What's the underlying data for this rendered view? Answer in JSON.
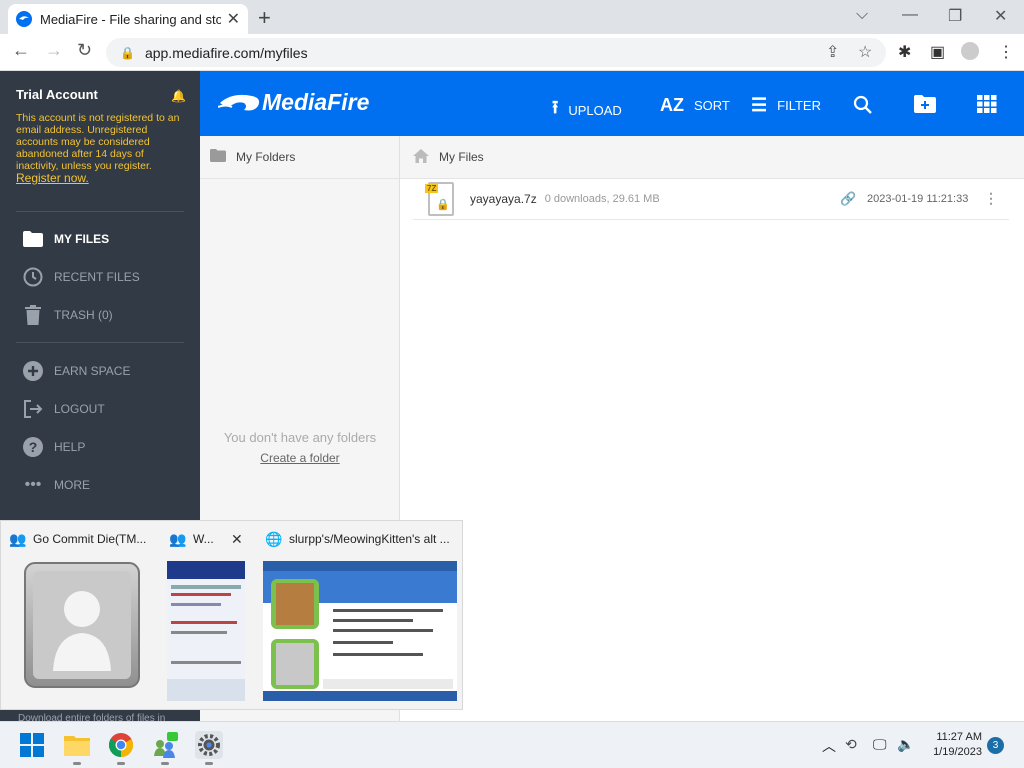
{
  "browser": {
    "tab_title": "MediaFire - File sharing and stor",
    "tab_close": "✕",
    "new_tab": "+",
    "url": "app.mediafire.com/myfiles",
    "win_min": "⌵",
    "win_minimize": "—",
    "win_restore": "❐",
    "win_close": "✕"
  },
  "sidebar": {
    "account_title": "Trial Account",
    "trial_message": "This account is not registered to an email address. Unregistered accounts may be considered abandoned after 14 days of inactivity, unless you register.",
    "register_link": "Register now.",
    "nav": [
      {
        "label": "MY FILES"
      },
      {
        "label": "RECENT FILES"
      },
      {
        "label": "TRASH (0)"
      },
      {
        "label": "EARN SPACE"
      },
      {
        "label": "LOGOUT"
      },
      {
        "label": "HELP"
      },
      {
        "label": "MORE"
      }
    ],
    "bottom_text": "Download entire folders of files in"
  },
  "header": {
    "logo_text": "MediaFire",
    "upload": "UPLOAD",
    "sort": "SORT",
    "filter": "FILTER",
    "accent_color": "#0070f0"
  },
  "folders_pane": {
    "title": "My Folders",
    "empty_text": "You don't have any folders",
    "create_link": "Create a folder"
  },
  "files_pane": {
    "title": "My Files",
    "files": [
      {
        "name": "yayayaya.7z",
        "meta": "0 downloads, 29.61 MB",
        "date": "2023-01-19 11:21:33",
        "type_tag": "7Z"
      }
    ]
  },
  "popup": {
    "windows": [
      {
        "title": "Go Commit Die(TM..."
      },
      {
        "title": "W..."
      },
      {
        "title": "slurpp's/MeowingKitten's alt ..."
      }
    ],
    "close": "✕"
  },
  "taskbar": {
    "time": "11:27 AM",
    "date": "1/19/2023",
    "notification_count": "3"
  }
}
